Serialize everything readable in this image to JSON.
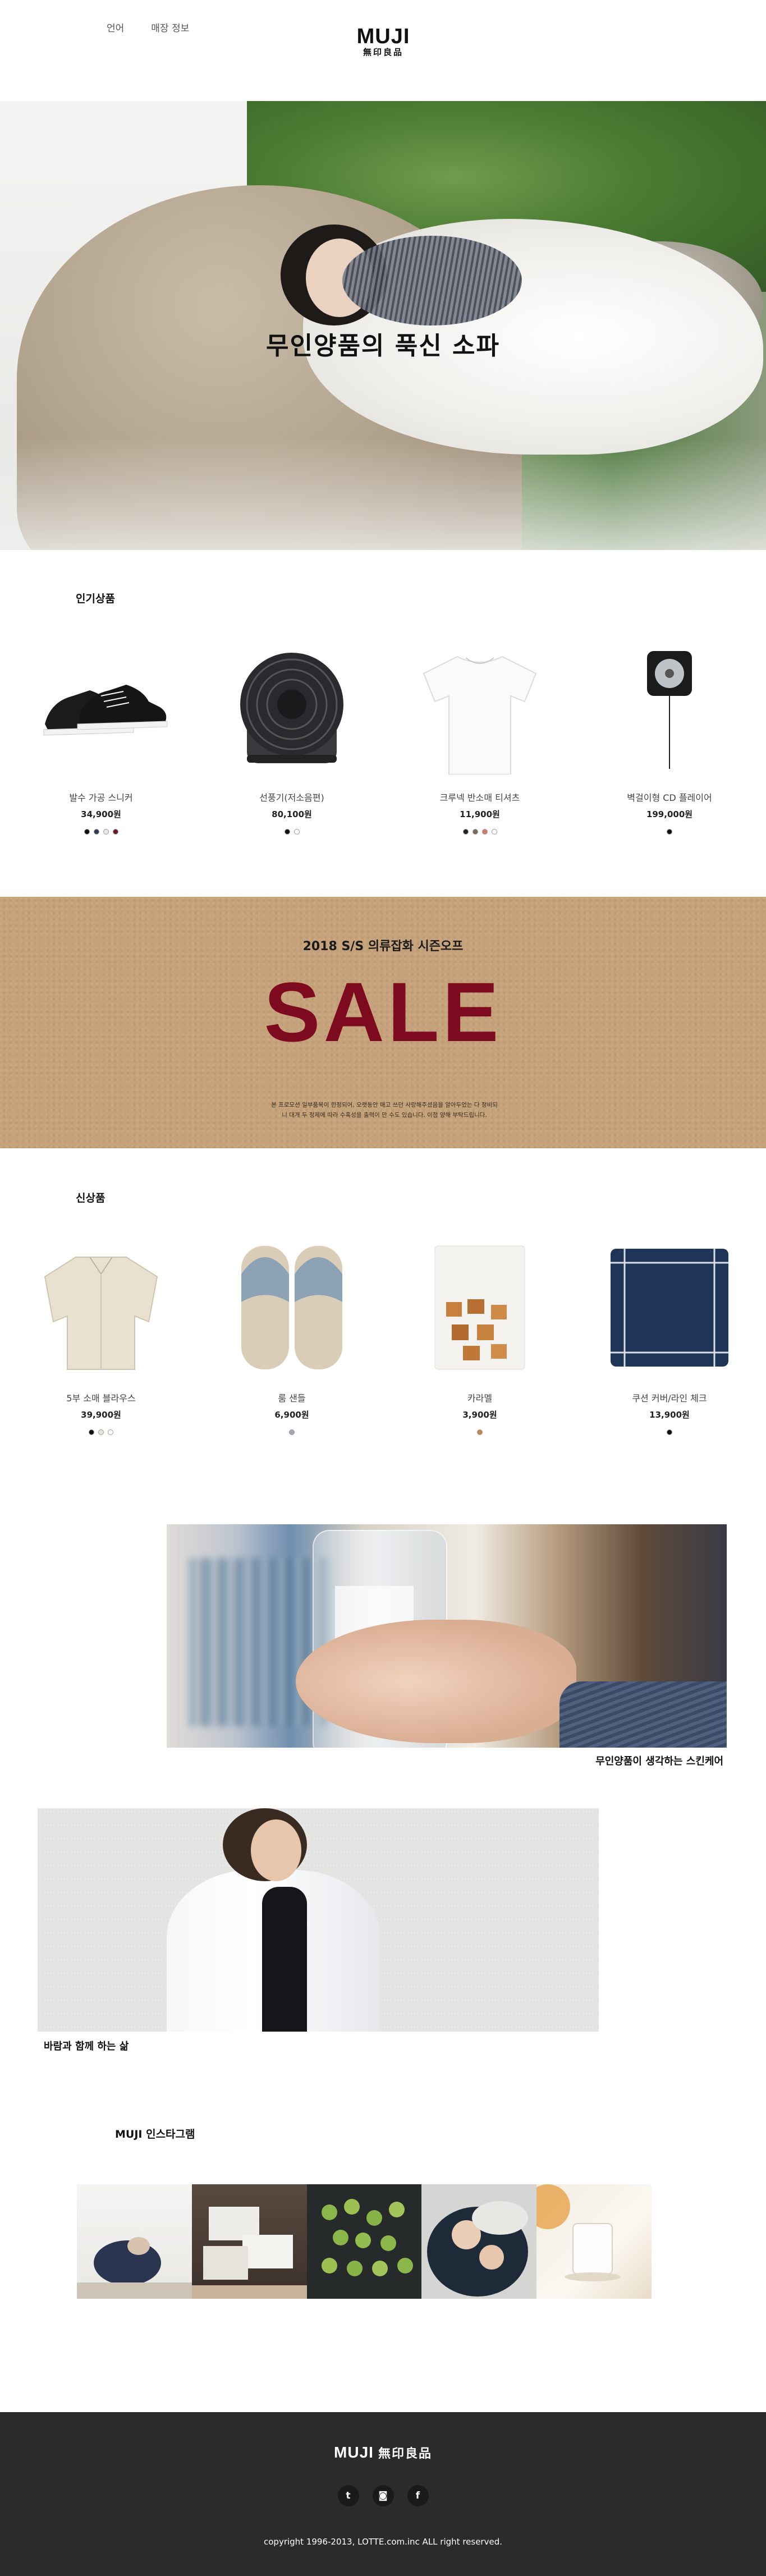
{
  "header": {
    "nav": [
      "언어",
      "매장 정보"
    ],
    "logo_top": "MUJI",
    "logo_bottom": "無印良品"
  },
  "hero": {
    "title": "무인양품의 푹신 소파"
  },
  "popular": {
    "heading": "인기상품",
    "items": [
      {
        "name": "발수 가공 스니커",
        "price": "34,900원",
        "colors": [
          "#111111",
          "#333a55",
          "#e8e8e8",
          "#6d1a1f"
        ],
        "icon": "sneaker-icon"
      },
      {
        "name": "선풍기(저소음편)",
        "price": "80,100원",
        "colors": [
          "#111111",
          "#ffffff"
        ],
        "icon": "fan-icon"
      },
      {
        "name": "크루넥 반소매 티셔츠",
        "price": "11,900원",
        "colors": [
          "#222222",
          "#7a6a5a",
          "#d87a6a",
          "#ffffff"
        ],
        "icon": "tshirt-icon"
      },
      {
        "name": "벽걸이형 CD 플레이어",
        "price": "199,000원",
        "colors": [
          "#111111"
        ],
        "icon": "cd-player-icon"
      }
    ]
  },
  "sale": {
    "subtitle": "2018 S/S 의류잡화 시즌오프",
    "headline": "SALE",
    "note": "본 프로모션 일부품목이 한정되어, 오랫동안 매고 쓰던 사랑해주셨음을 알아두었는 다 정비되니 대개 두 정제에 따라 수혹성을 출력이 만 수도 있습니다. 이점 양해 부탁드립니다."
  },
  "new_items": {
    "heading": "신상품",
    "items": [
      {
        "name": "5부 소매 블라우스",
        "price": "39,900원",
        "colors": [
          "#111111",
          "#ece6d8",
          "#ffffff"
        ],
        "icon": "blouse-icon"
      },
      {
        "name": "룸 샌들",
        "price": "6,900원",
        "colors": [
          "#9fa7b0"
        ],
        "icon": "slippers-icon"
      },
      {
        "name": "카라멜",
        "price": "3,900원",
        "colors": [
          "#c0864e"
        ],
        "icon": "caramel-icon"
      },
      {
        "name": "쿠션 커버/라인 체크",
        "price": "13,900원",
        "colors": [
          "#111111"
        ],
        "icon": "cushion-icon"
      }
    ]
  },
  "features": {
    "skincare_caption": "무인양품이 생각하는 스킨케어",
    "wind_caption": "바람과 함께 하는 삶"
  },
  "instagram": {
    "heading": "MUJI 인스타그램",
    "tiles": [
      "beanbag-photo",
      "storage-boxes-photo",
      "apples-photo",
      "sleeping-people-photo",
      "glass-cup-photo"
    ]
  },
  "footer": {
    "logo_a": "MUJI",
    "logo_b": "無印良品",
    "social": [
      {
        "name": "twitter-icon",
        "glyph": "t"
      },
      {
        "name": "instagram-icon",
        "glyph": "◙"
      },
      {
        "name": "facebook-icon",
        "glyph": "f"
      }
    ],
    "copyright": "copyright 1996-2013, LOTTE.com.inc ALL right reserved."
  }
}
